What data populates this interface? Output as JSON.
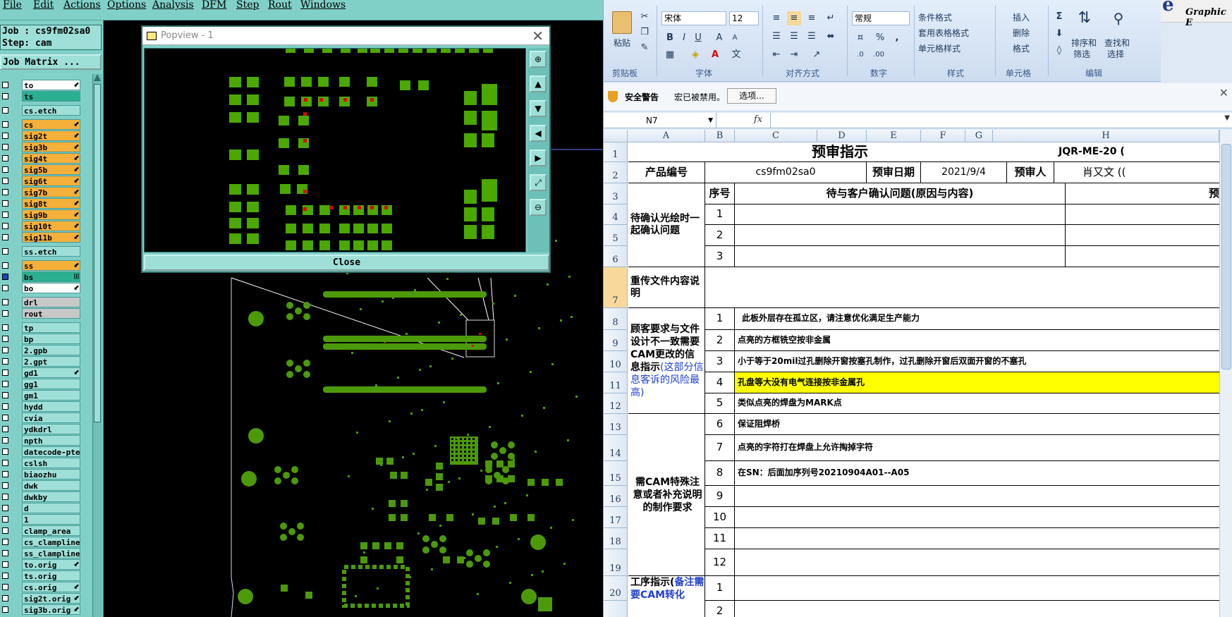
{
  "cam": {
    "menu": [
      "File",
      "Edit",
      "Actions",
      "Options",
      "Analysis",
      "DFM",
      "Step",
      "Rout",
      "Windows"
    ],
    "job_line": "Job : cs9fm02sa0",
    "step_line": "Step: cam",
    "job_matrix_label": "Job Matrix ...",
    "layers": [
      {
        "name": "to",
        "color": "white",
        "ind": "⬋"
      },
      {
        "name": "ts",
        "color": "teal",
        "ind": ""
      },
      {
        "name": "cs.etch",
        "color": "aqua",
        "ind": ""
      },
      {
        "name": "cs",
        "color": "orange",
        "ind": "⬋"
      },
      {
        "name": "sig2t",
        "color": "orange",
        "ind": "⬋"
      },
      {
        "name": "sig3b",
        "color": "orange",
        "ind": "⬋"
      },
      {
        "name": "sig4t",
        "color": "orange",
        "ind": "⬋"
      },
      {
        "name": "sig5b",
        "color": "orange",
        "ind": "⬋"
      },
      {
        "name": "sig6t",
        "color": "orange",
        "ind": "⬋"
      },
      {
        "name": "sig7b",
        "color": "orange",
        "ind": "⬋"
      },
      {
        "name": "sig8t",
        "color": "orange",
        "ind": "⬋"
      },
      {
        "name": "sig9b",
        "color": "orange",
        "ind": "⬋"
      },
      {
        "name": "sig10t",
        "color": "orange",
        "ind": "⬋"
      },
      {
        "name": "sig11b",
        "color": "orange",
        "ind": "⬋"
      },
      {
        "name": "ss.etch",
        "color": "aqua",
        "ind": ""
      },
      {
        "name": "ss",
        "color": "orange",
        "ind": "⬋"
      },
      {
        "name": "bs",
        "color": "teal",
        "ind": "⊞"
      },
      {
        "name": "bo",
        "color": "white",
        "ind": "⬋"
      },
      {
        "name": "drl",
        "color": "gray",
        "ind": ""
      },
      {
        "name": "rout",
        "color": "gray",
        "ind": ""
      },
      {
        "name": "tp",
        "color": "aqua",
        "ind": ""
      },
      {
        "name": "bp",
        "color": "aqua",
        "ind": ""
      },
      {
        "name": "2.gpb",
        "color": "aqua",
        "ind": ""
      },
      {
        "name": "2.gpt",
        "color": "aqua",
        "ind": ""
      },
      {
        "name": "gd1",
        "color": "aqua",
        "ind": "⬋"
      },
      {
        "name": "gg1",
        "color": "aqua",
        "ind": ""
      },
      {
        "name": "gm1",
        "color": "aqua",
        "ind": ""
      },
      {
        "name": "hydd",
        "color": "aqua",
        "ind": ""
      },
      {
        "name": "cvia",
        "color": "aqua",
        "ind": ""
      },
      {
        "name": "ydkdrl",
        "color": "aqua",
        "ind": ""
      },
      {
        "name": "npth",
        "color": "aqua",
        "ind": ""
      },
      {
        "name": "datecode-pte",
        "color": "aqua",
        "ind": ""
      },
      {
        "name": "cslsh",
        "color": "aqua",
        "ind": ""
      },
      {
        "name": "biaozhu",
        "color": "aqua",
        "ind": ""
      },
      {
        "name": "dwk",
        "color": "aqua",
        "ind": ""
      },
      {
        "name": "dwkby",
        "color": "aqua",
        "ind": ""
      },
      {
        "name": "d",
        "color": "aqua",
        "ind": ""
      },
      {
        "name": "1",
        "color": "aqua",
        "ind": ""
      },
      {
        "name": "clamp_area",
        "color": "aqua",
        "ind": ""
      },
      {
        "name": "cs_clampline",
        "color": "aqua",
        "ind": ""
      },
      {
        "name": "ss_clampline",
        "color": "aqua",
        "ind": ""
      },
      {
        "name": "to.orig",
        "color": "aqua",
        "ind": "⬋"
      },
      {
        "name": "ts.orig",
        "color": "aqua",
        "ind": ""
      },
      {
        "name": "cs.orig",
        "color": "aqua",
        "ind": "⬋"
      },
      {
        "name": "sig2t.orig",
        "color": "aqua",
        "ind": "⬋"
      },
      {
        "name": "sig3b.orig",
        "color": "aqua",
        "ind": "⬋"
      }
    ],
    "popview": {
      "title": "Popview - 1",
      "close_label": "Close"
    },
    "colors": {
      "board_copper": "#4c9a0a",
      "popview_pad": "#4aa800",
      "marker_red": "#e00000"
    }
  },
  "excel": {
    "ribbon": {
      "paste_label": "粘贴",
      "font_name": "宋体",
      "font_size": "12",
      "number_format": "常规",
      "cond_format": "条件格式",
      "table_format": "套用表格格式",
      "cell_style": "单元格样式",
      "insert": "插入",
      "delete": "删除",
      "format": "格式",
      "sort_filter_1": "排序和",
      "sort_filter_2": "筛选",
      "find_select_1": "查找和",
      "find_select_2": "选择",
      "groups": [
        "剪贴板",
        "字体",
        "对齐方式",
        "数字",
        "样式",
        "单元格",
        "编辑"
      ]
    },
    "brand_sub": "Graphic E",
    "security": {
      "title": "安全警告",
      "message": "宏已被禁用。",
      "button": "选项..."
    },
    "namebox": "N7",
    "columns": [
      "A",
      "B",
      "C",
      "D",
      "E",
      "F",
      "G",
      "H"
    ],
    "rows": [
      "1",
      "2",
      "3",
      "4",
      "5",
      "6",
      "7",
      "8",
      "9",
      "10",
      "11",
      "12",
      "13",
      "14",
      "15",
      "16",
      "17",
      "18",
      "19",
      "20"
    ],
    "cells": {
      "title": "预审指示",
      "doc_code": "JQR-ME-20 (",
      "prod_no_label": "产品编号",
      "prod_no": "cs9fm02sa0",
      "review_date_label": "预审日期",
      "review_date": "2021/9/4",
      "reviewer_label": "预审人",
      "reviewer": "肖又文 ((",
      "confirm_section": "待确认光绘时一起确认问题",
      "seq_header": "序号",
      "pending_header": "待与客户确认问题(原因与内容)",
      "pre_header": "预",
      "reupload_section": "重传文件内容说明",
      "mismatch_section_black": "顾客要求与文件设计不一致需要CAM更改的信息指示",
      "mismatch_section_blue": "(这部分信息客诉的风险最高)",
      "special_section": "需CAM特殊注意或者补充说明的制作要求",
      "process_section_black": "工序指示(",
      "process_section_blue": "备注需要CAM转化",
      "seq": [
        "1",
        "2",
        "3",
        "1",
        "2",
        "3",
        "4",
        "5",
        "6",
        "7",
        "8",
        "9",
        "10",
        "11",
        "12",
        "1",
        "2"
      ],
      "items": [
        "此板外层存在孤立区，请注意优化满足生产能力",
        "点亮的方框铣空按非金属",
        "小于等于20mil过孔删除开窗按塞孔制作，过孔删除开窗后双面开窗的不塞孔",
        "孔盘等大没有电气连接按非金属孔",
        "类似点亮的焊盘为MARK点",
        "保证阻焊桥",
        "点亮的字符打在焊盘上允许掏掉字符",
        "在SN：后面加序列号20210904A01--A05"
      ],
      "highlight_color": "#ffff00",
      "blue_text_color": "#1f3fd0"
    }
  }
}
